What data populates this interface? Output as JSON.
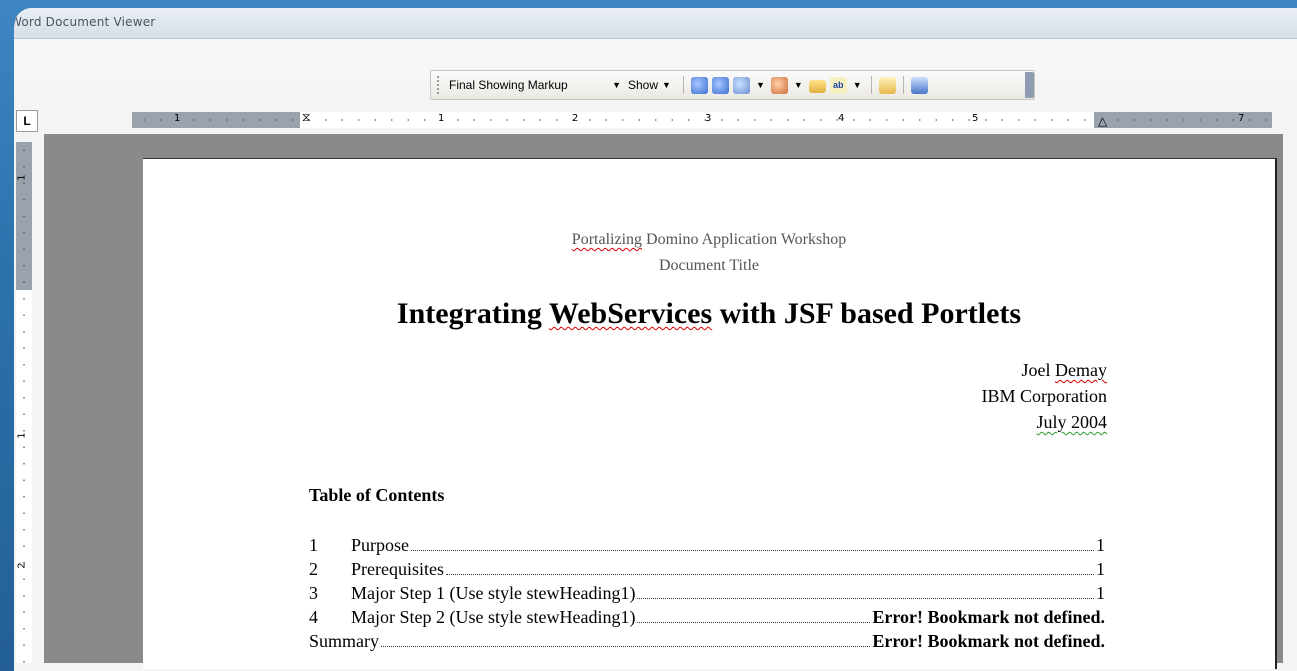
{
  "window": {
    "title": "Word Document Viewer"
  },
  "toolbar": {
    "markup_mode": "Final Showing Markup",
    "show_label": "Show",
    "icons": [
      "previous-change-icon",
      "next-change-icon",
      "accept-change-icon",
      "reject-change-icon",
      "new-comment-icon",
      "highlight-icon",
      "track-changes-icon",
      "reviewing-pane-icon"
    ]
  },
  "ruler": {
    "corner": "L",
    "numbers": [
      "1",
      "1",
      "2",
      "3",
      "4",
      "5",
      "7"
    ],
    "vertical_numbers": [
      "1",
      "1",
      "2"
    ]
  },
  "document": {
    "header_line1_a": "Portalizing",
    "header_line1_b": " Domino Application Workshop",
    "header_line2": "Document Title",
    "title_a": "Integrating ",
    "title_b": "WebServices",
    "title_c": " with JSF based Portlets",
    "author_a": "Joel ",
    "author_b": "Demay",
    "company": "IBM Corporation",
    "date": "July  2004",
    "toc_heading": "Table of Contents",
    "toc": [
      {
        "num": "1",
        "text": "Purpose",
        "page": "1",
        "error": false
      },
      {
        "num": "2",
        "text": "Prerequisites",
        "page": "1",
        "error": false
      },
      {
        "num": "3",
        "text": "Major Step 1 (Use style stewHeading1)",
        "page": "1",
        "error": false
      },
      {
        "num": "4",
        "text": "Major Step 2 (Use style stewHeading1)",
        "page": "Error! Bookmark not defined.",
        "error": true
      },
      {
        "num": "",
        "text": "Summary",
        "page": "Error! Bookmark not defined.",
        "error": true
      }
    ]
  },
  "colors": {
    "frame": "#2b72ad",
    "workspace": "#8a8a8a",
    "spell_underline": "#dd0000",
    "grammar_underline": "#2a9d2a"
  }
}
